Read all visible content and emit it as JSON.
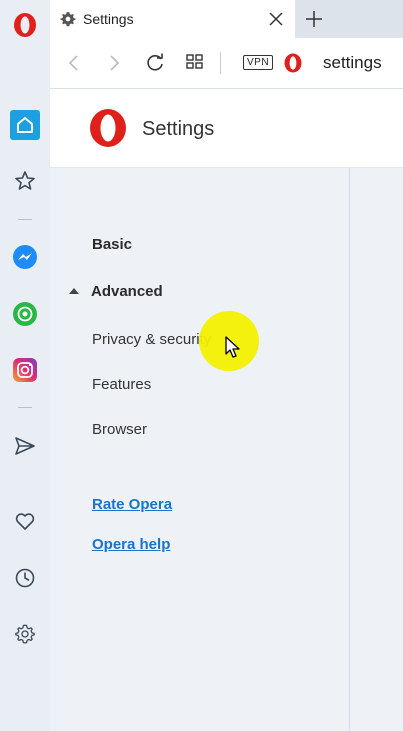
{
  "tab": {
    "title": "Settings"
  },
  "address": {
    "vpn_label": "VPN",
    "url_text": "settings"
  },
  "page": {
    "title": "Settings"
  },
  "menu": {
    "basic": "Basic",
    "advanced": "Advanced",
    "items": [
      "Privacy & security",
      "Features",
      "Browser"
    ],
    "links": [
      "Rate Opera",
      "Opera help"
    ]
  },
  "colors": {
    "opera_red": "#e0201a",
    "sidebar_bg": "#e9eef5",
    "menu_bg": "#eef2f7",
    "home_active": "#1ea0e0",
    "messenger": "#1d8cf6",
    "whatsapp": "#29b845",
    "link": "#1a73c8",
    "cursor_highlight": "#f2f000"
  },
  "sidebar_icons": [
    "opera-logo-icon",
    "home-icon",
    "star-icon",
    "messenger-icon",
    "whatsapp-icon",
    "instagram-icon",
    "send-icon",
    "heart-icon",
    "history-icon",
    "settings-gear-icon"
  ]
}
